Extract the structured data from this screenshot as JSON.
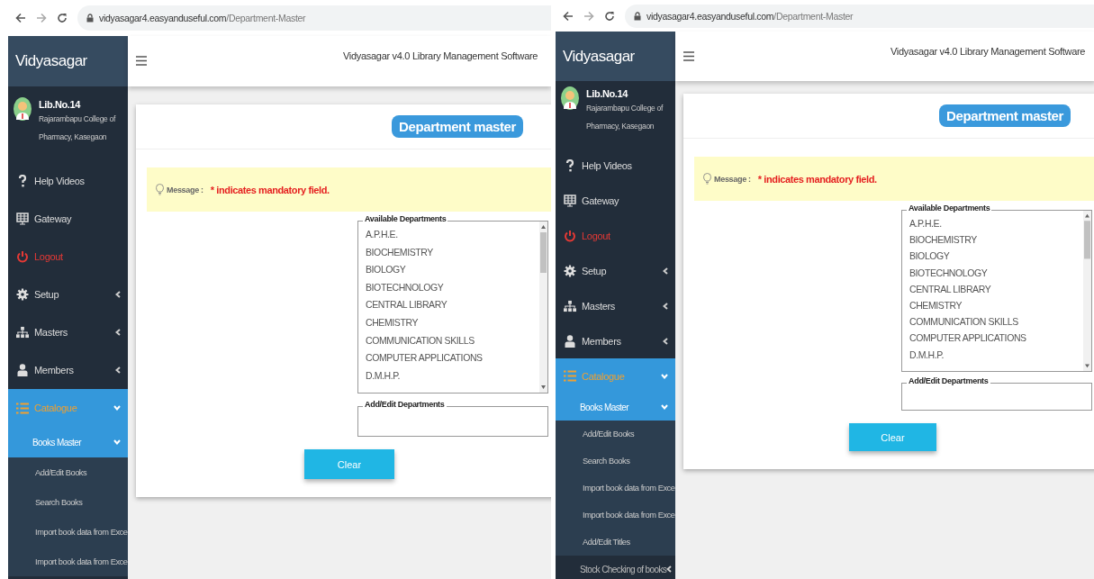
{
  "panels": [
    {
      "browser": {
        "url_host": "vidyasagar4.easyanduseful.com",
        "url_path": "/Department-Master"
      },
      "brand": "Vidyasagar",
      "app_title": "Vidyasagar v4.0 Library Management Software",
      "user": {
        "name": "Lib.No.14",
        "org": "Rajarambapu College of Pharmacy, Kasegaon"
      },
      "menu": [
        {
          "kind": "link",
          "label": "Help Videos",
          "selected": false
        },
        {
          "kind": "link",
          "label": "Gateway",
          "selected": false
        },
        {
          "kind": "logout",
          "label": "Logout",
          "selected": false
        },
        {
          "kind": "group",
          "label": "Setup",
          "selected": false,
          "expanded": false
        },
        {
          "kind": "group",
          "label": "Masters",
          "selected": false,
          "expanded": false
        },
        {
          "kind": "group",
          "label": "Members",
          "selected": false,
          "expanded": false
        },
        {
          "kind": "group",
          "label": "Catalogue",
          "selected": true,
          "expanded": true,
          "children": [
            {
              "kind": "group",
              "label": "Books Master",
              "selected": true,
              "expanded": true,
              "children": [
                {
                  "label": "Add/Edit Books",
                  "selected": false
                },
                {
                  "label": "Search Books",
                  "selected": false
                },
                {
                  "label": "Import book data from Exce",
                  "selected": false
                },
                {
                  "label": "Import book data from Exce",
                  "selected": false
                }
              ]
            }
          ]
        }
      ],
      "page_title": "Department master",
      "message": {
        "label": "Message :",
        "text": "* indicates mandatory field."
      },
      "available": {
        "legend": "Available Departments",
        "items": [
          "A.P.H.E.",
          "BIOCHEMISTRY",
          "BIOLOGY",
          "BIOTECHNOLOGY",
          "CENTRAL LIBRARY",
          "CHEMISTRY",
          "COMMUNICATION SKILLS",
          "COMPUTER APPLICATIONS",
          "D.M.H.P."
        ]
      },
      "add_edit": {
        "legend": "Add/Edit Departments"
      },
      "clear_button": "Clear"
    },
    {
      "browser": {
        "url_host": "vidyasagar4.easyanduseful.com",
        "url_path": "/Department-Master"
      },
      "brand": "Vidyasagar",
      "app_title": "Vidyasagar v4.0 Library Management Software",
      "user": {
        "name": "Lib.No.14",
        "org": "Rajarambapu College of Pharmacy, Kasegaon"
      },
      "menu": [
        {
          "kind": "link",
          "label": "Help Videos",
          "selected": false
        },
        {
          "kind": "link",
          "label": "Gateway",
          "selected": false
        },
        {
          "kind": "logout",
          "label": "Logout",
          "selected": false
        },
        {
          "kind": "group",
          "label": "Setup",
          "selected": false,
          "expanded": false
        },
        {
          "kind": "group",
          "label": "Masters",
          "selected": false,
          "expanded": false
        },
        {
          "kind": "group",
          "label": "Members",
          "selected": false,
          "expanded": false
        },
        {
          "kind": "group",
          "label": "Catalogue",
          "selected": true,
          "expanded": true,
          "children": [
            {
              "kind": "group",
              "label": "Books Master",
              "selected": true,
              "expanded": true,
              "children": [
                {
                  "label": "Add/Edit Books",
                  "selected": false
                },
                {
                  "label": "Search Books",
                  "selected": false
                },
                {
                  "label": "Import book data from Exce",
                  "selected": false
                },
                {
                  "label": "Import book data from Exce",
                  "selected": false
                },
                {
                  "label": "Add/Edit Titles",
                  "selected": false
                }
              ]
            },
            {
              "kind": "group",
              "label": "Stock Checking of books",
              "selected": false,
              "expanded": false
            }
          ]
        }
      ],
      "page_title": "Department master",
      "message": {
        "label": "Message :",
        "text": "* indicates mandatory field."
      },
      "available": {
        "legend": "Available Departments",
        "items": [
          "A.P.H.E.",
          "BIOCHEMISTRY",
          "BIOLOGY",
          "BIOTECHNOLOGY",
          "CENTRAL LIBRARY",
          "CHEMISTRY",
          "COMMUNICATION SKILLS",
          "COMPUTER APPLICATIONS",
          "D.M.H.P."
        ]
      },
      "add_edit": {
        "legend": "Add/Edit Departments"
      },
      "clear_button": "Clear"
    }
  ]
}
